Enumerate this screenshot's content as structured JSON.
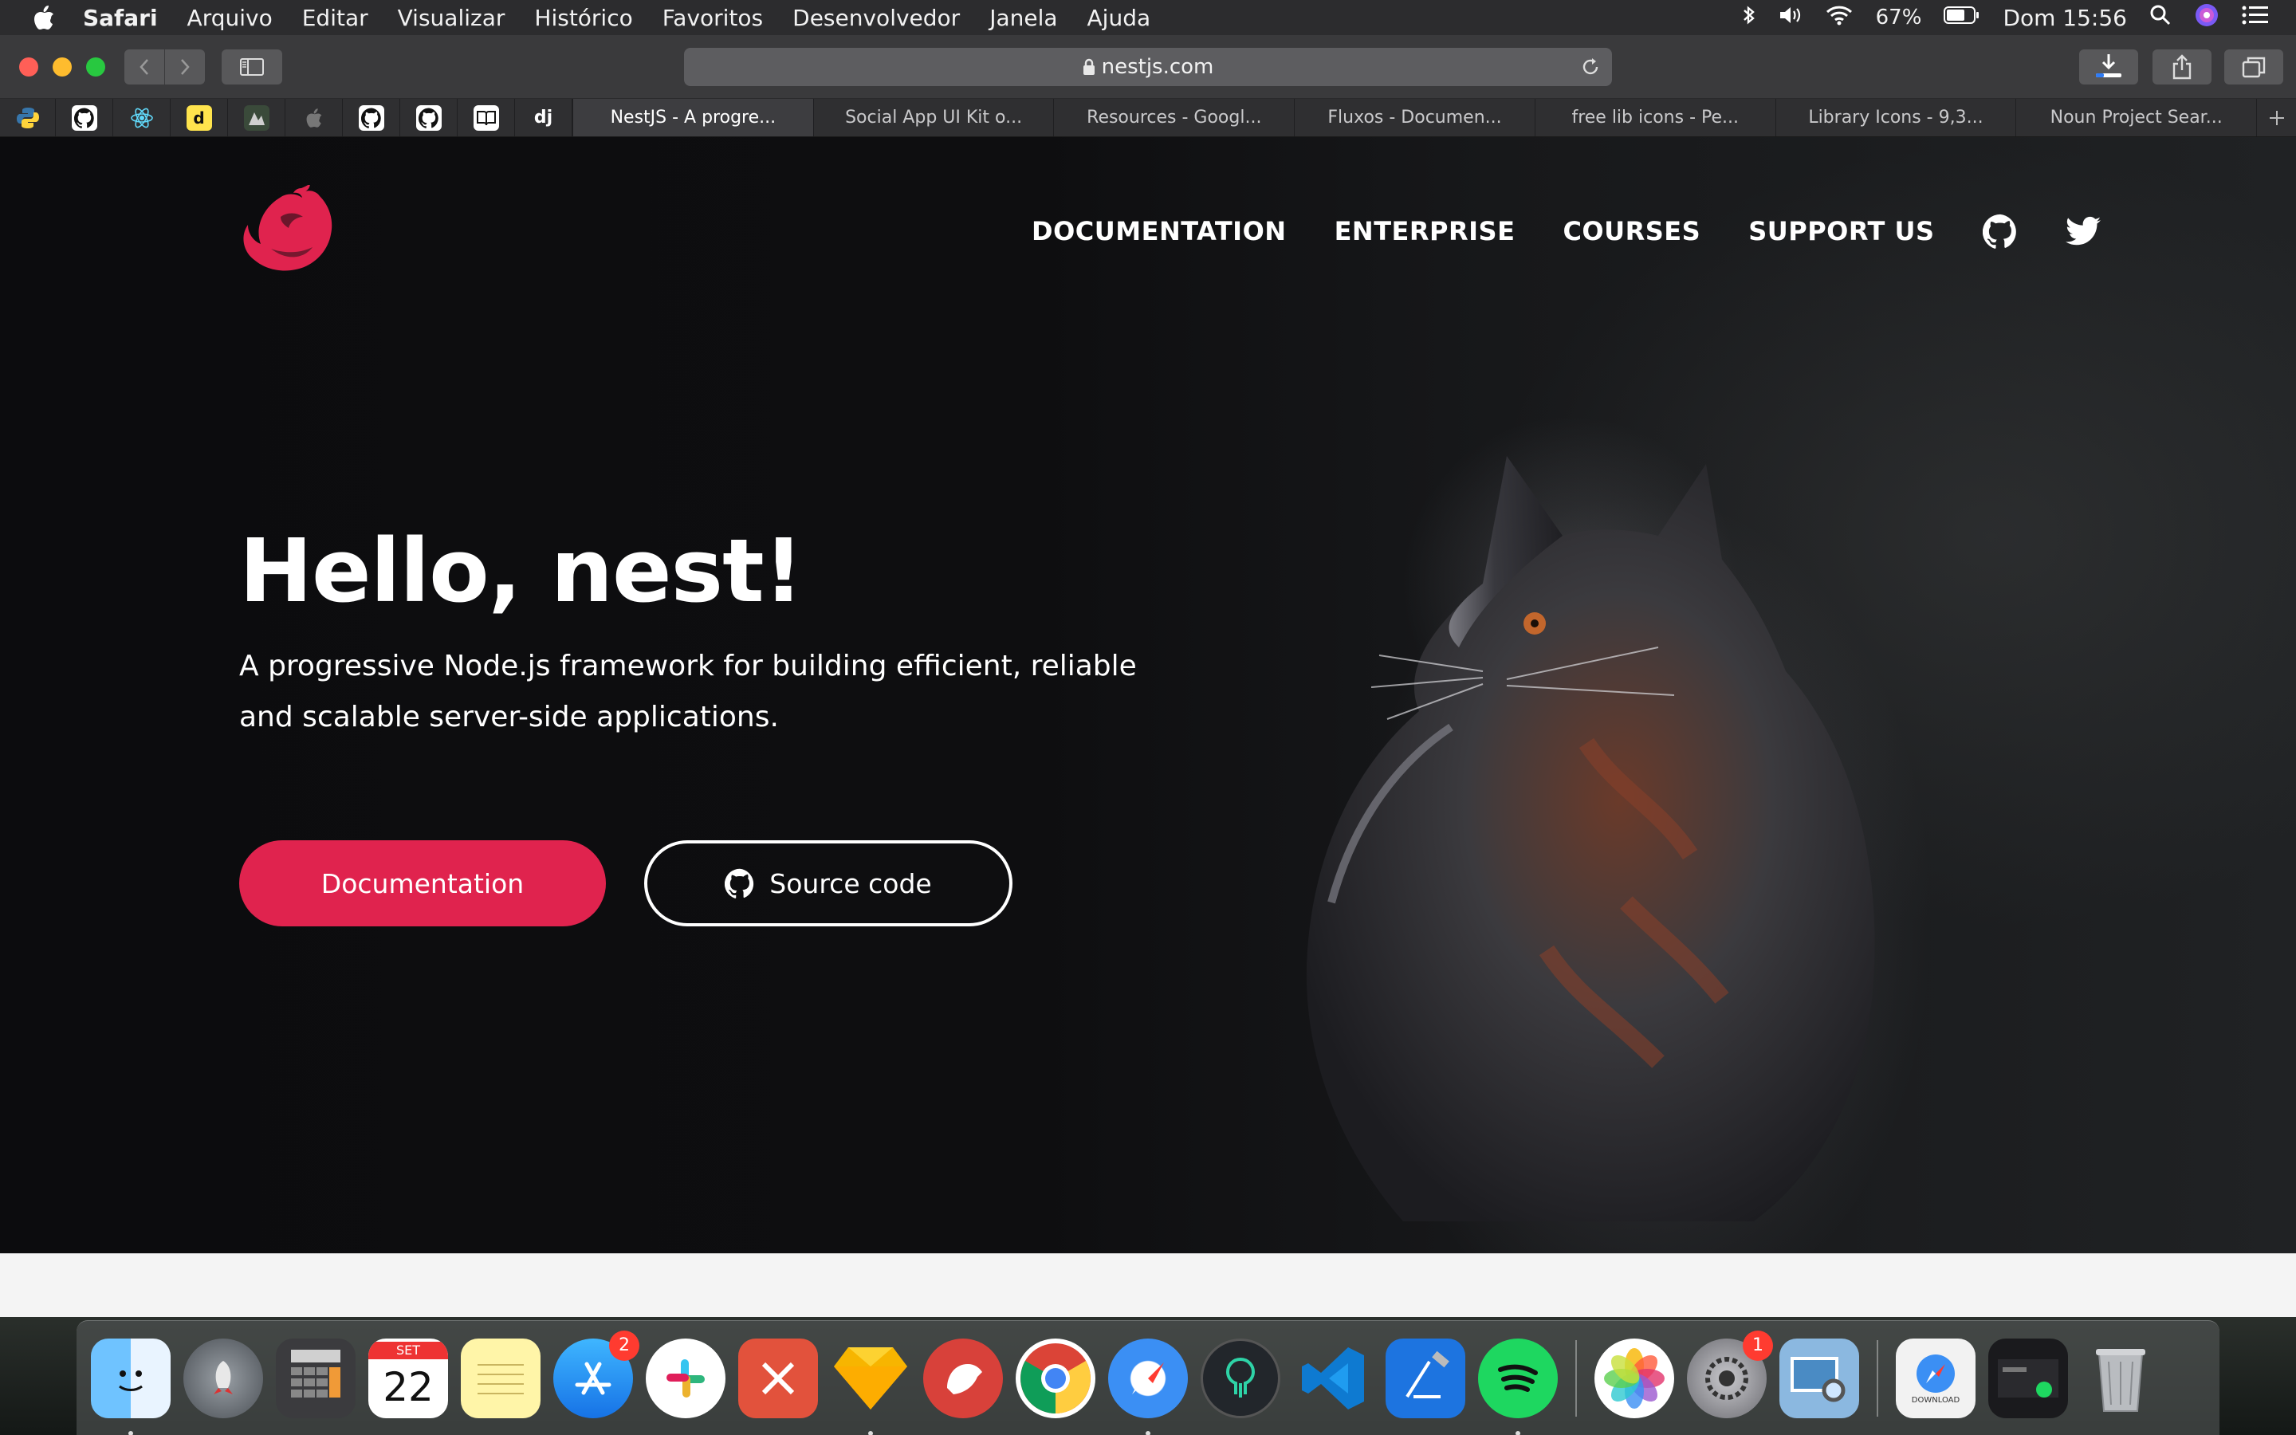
{
  "menubar": {
    "app_name": "Safari",
    "items": [
      "Arquivo",
      "Editar",
      "Visualizar",
      "Histórico",
      "Favoritos",
      "Desenvolvedor",
      "Janela",
      "Ajuda"
    ],
    "battery": "67%",
    "clock": "Dom 15:56"
  },
  "toolbar": {
    "url": "nestjs.com"
  },
  "bookmarks": {
    "dj_label": "dj",
    "d_label": "d"
  },
  "tabs": [
    {
      "label": "NestJS - A progre...",
      "active": true
    },
    {
      "label": "Social App UI Kit o...",
      "active": false
    },
    {
      "label": "Resources - Googl...",
      "active": false
    },
    {
      "label": "Fluxos - Documen...",
      "active": false
    },
    {
      "label": "free lib icons - Pe...",
      "active": false
    },
    {
      "label": "Library Icons - 9,3...",
      "active": false
    },
    {
      "label": "Noun Project Sear...",
      "active": false
    }
  ],
  "site": {
    "nav": [
      "DOCUMENTATION",
      "ENTERPRISE",
      "COURSES",
      "SUPPORT US"
    ],
    "hero_title": "Hello, nest!",
    "hero_subtitle": "A progressive Node.js framework for building efficient, reliable and scalable server-side applications.",
    "primary_button": "Documentation",
    "secondary_button": "Source code",
    "accent_color": "#e0234e"
  },
  "dock": {
    "calendar_month": "SET",
    "calendar_day": "22",
    "appstore_badge": "2",
    "settings_badge": "1",
    "download_label": "DOWNLOAD"
  }
}
